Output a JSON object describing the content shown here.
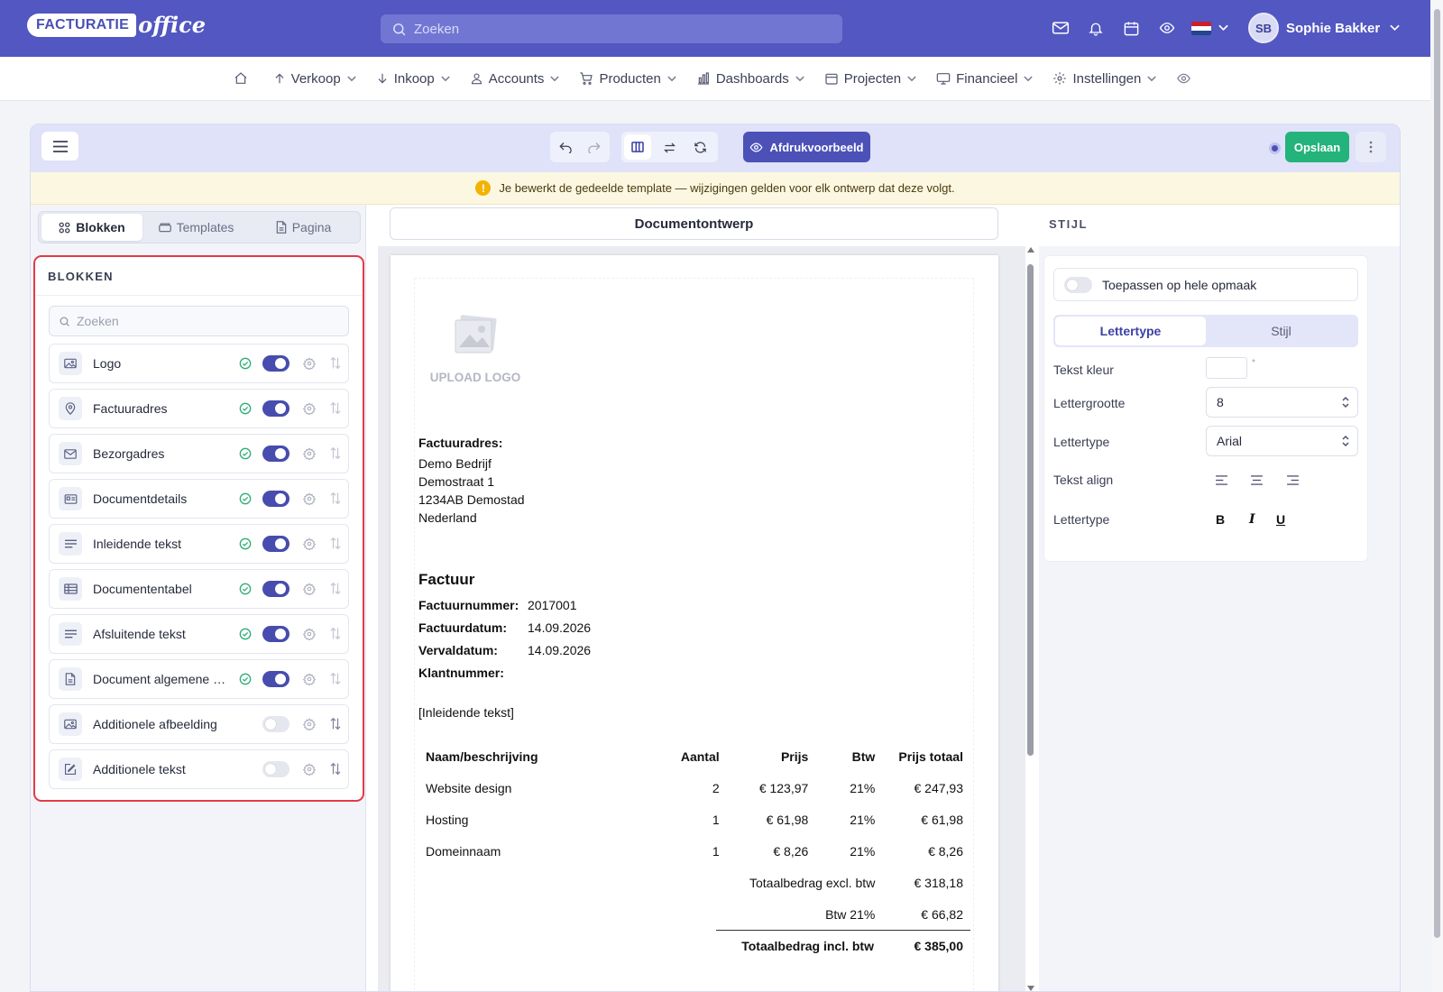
{
  "header": {
    "logo_part1": "FACTURATIE",
    "logo_part2": "office",
    "search_placeholder": "Zoeken",
    "user_initials": "SB",
    "user_name": "Sophie Bakker",
    "accent": "#5257c1"
  },
  "nav": {
    "items": [
      {
        "label": "Verkoop",
        "icon": "arrow-up-icon"
      },
      {
        "label": "Inkoop",
        "icon": "arrow-down-icon"
      },
      {
        "label": "Accounts",
        "icon": "user-icon"
      },
      {
        "label": "Producten",
        "icon": "cart-icon"
      },
      {
        "label": "Dashboards",
        "icon": "bar-chart-icon"
      },
      {
        "label": "Projecten",
        "icon": "calendar-icon"
      },
      {
        "label": "Financieel",
        "icon": "monitor-icon"
      },
      {
        "label": "Instellingen",
        "icon": "gear-icon"
      }
    ]
  },
  "toolbar": {
    "preview_label": "Afdrukvoorbeeld",
    "save_label": "Opslaan",
    "save_color": "#24b37b"
  },
  "banner": {
    "text": "Je bewerkt de gedeelde template — wijzigingen gelden voor elk ontwerp dat deze volgt."
  },
  "left": {
    "tabs": [
      "Blokken",
      "Templates",
      "Pagina"
    ],
    "active_tab": "Blokken",
    "panel_title": "BLOKKEN",
    "search_placeholder": "Zoeken",
    "blocks": [
      {
        "label": "Logo",
        "icon": "image-icon",
        "enabled": true
      },
      {
        "label": "Factuuradres",
        "icon": "map-pin-icon",
        "enabled": true
      },
      {
        "label": "Bezorgadres",
        "icon": "mail-icon",
        "enabled": true
      },
      {
        "label": "Documentdetails",
        "icon": "id-card-icon",
        "enabled": true
      },
      {
        "label": "Inleidende tekst",
        "icon": "text-lines-icon",
        "enabled": true
      },
      {
        "label": "Documententabel",
        "icon": "table-icon",
        "enabled": true
      },
      {
        "label": "Afsluitende tekst",
        "icon": "text-lines-icon",
        "enabled": true
      },
      {
        "label": "Document algemene v...",
        "icon": "file-icon",
        "enabled": true
      },
      {
        "label": "Additionele afbeelding",
        "icon": "image-icon",
        "enabled": false
      },
      {
        "label": "Additionele tekst",
        "icon": "edit-icon",
        "enabled": false
      }
    ]
  },
  "middle": {
    "title": "Documentontwerp",
    "upload_logo": "UPLOAD LOGO",
    "address_title": "Factuuradres:",
    "address_lines": [
      "Demo Bedrijf",
      "Demostraat 1",
      "1234AB Demostad",
      "Nederland"
    ],
    "doc_title": "Factuur",
    "details": [
      {
        "label": "Factuurnummer:",
        "value": "2017001"
      },
      {
        "label": "Factuurdatum:",
        "value": "14.09.2026"
      },
      {
        "label": "Vervaldatum:",
        "value": "14.09.2026"
      },
      {
        "label": "Klantnummer:",
        "value": ""
      }
    ],
    "intro": "[Inleidende tekst]",
    "table": {
      "headers": [
        "Naam/beschrijving",
        "Aantal",
        "Prijs",
        "Btw",
        "Prijs totaal"
      ],
      "rows": [
        [
          "Website design",
          "2",
          "€ 123,97",
          "21%",
          "€ 247,93"
        ],
        [
          "Hosting",
          "1",
          "€ 61,98",
          "21%",
          "€ 61,98"
        ],
        [
          "Domeinnaam",
          "1",
          "€ 8,26",
          "21%",
          "€ 8,26"
        ]
      ],
      "totals": [
        {
          "label": "Totaalbedrag excl. btw",
          "value": "€ 318,18"
        },
        {
          "label": "Btw 21%",
          "value": "€ 66,82"
        },
        {
          "label": "Totaalbedrag incl. btw",
          "value": "€ 385,00"
        }
      ]
    }
  },
  "right": {
    "title": "STIJL",
    "apply_label": "Toepassen op hele opmaak",
    "tabs": [
      "Lettertype",
      "Stijl"
    ],
    "active_tab": "Lettertype",
    "text_color_label": "Tekst kleur",
    "font_size_label": "Lettergrootte",
    "font_size_value": "8",
    "font_label": "Lettertype",
    "font_value": "Arial",
    "align_label": "Tekst align",
    "format_label": "Lettertype",
    "bold": "B",
    "italic": "I",
    "underline": "U",
    "required_mark": "*"
  }
}
